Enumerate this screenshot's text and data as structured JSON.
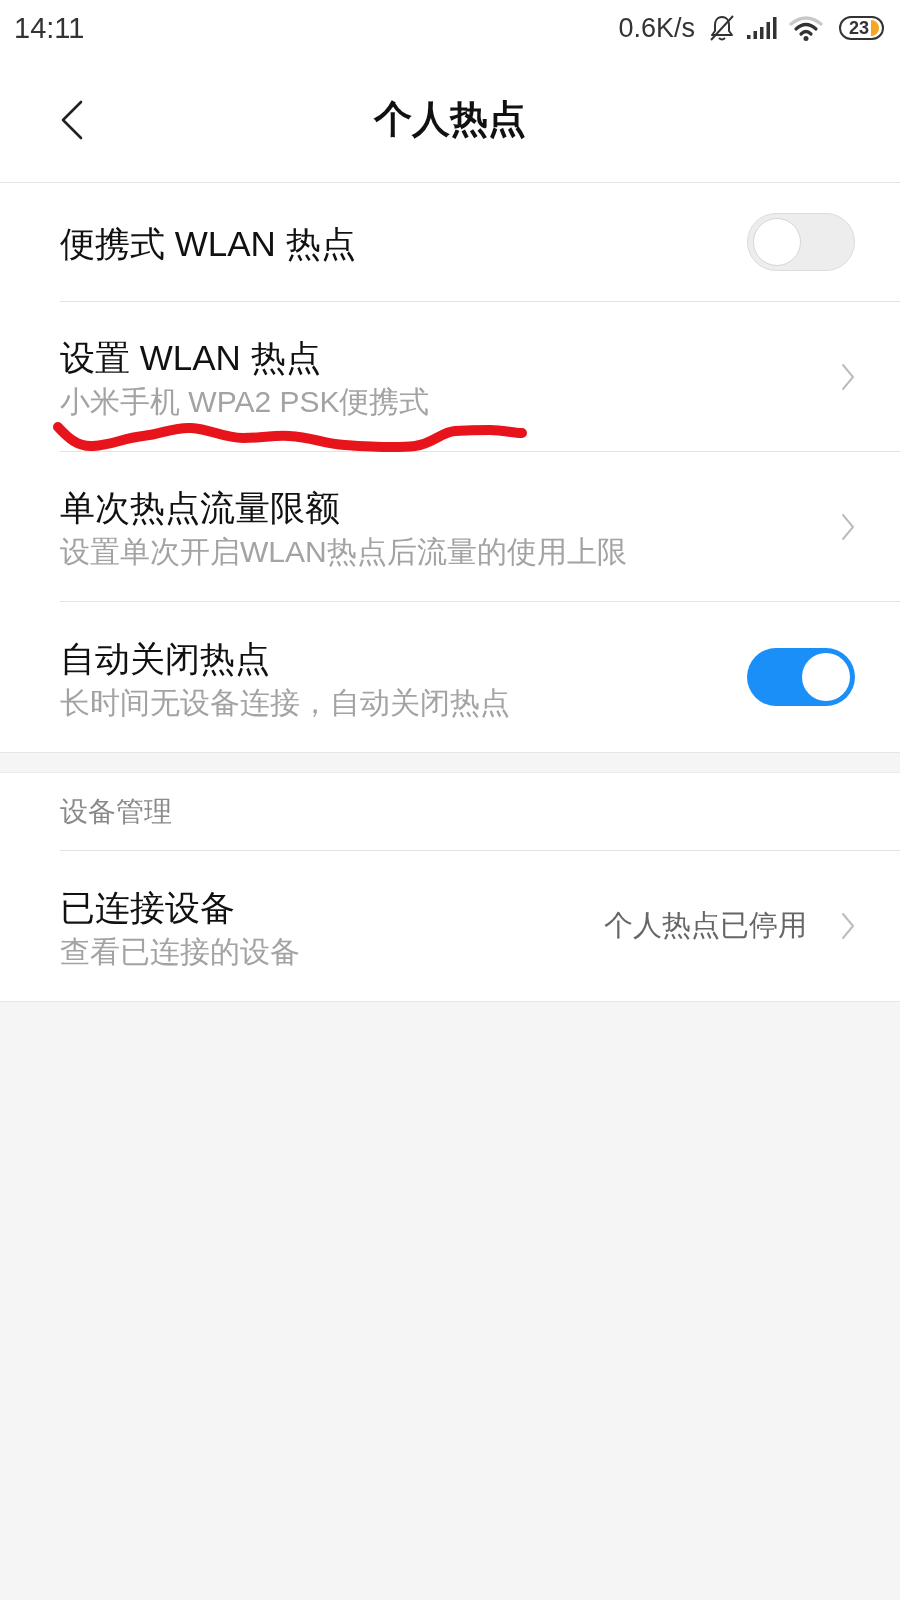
{
  "status_bar": {
    "time": "14:11",
    "net_speed": "0.6K/s",
    "battery": "23"
  },
  "header": {
    "title": "个人热点"
  },
  "groups": [
    {
      "items": [
        {
          "kind": "switch",
          "title": "便携式 WLAN 热点",
          "on": false,
          "underlined": false
        },
        {
          "kind": "link",
          "title": "设置 WLAN 热点",
          "subtitle": "小米手机 WPA2 PSK便携式",
          "underlined": true
        },
        {
          "kind": "link",
          "title": "单次热点流量限额",
          "subtitle": "设置单次开启WLAN热点后流量的使用上限",
          "underlined": false
        },
        {
          "kind": "switch",
          "title": "自动关闭热点",
          "subtitle": "长时间无设备连接，自动关闭热点",
          "on": true,
          "underlined": false
        }
      ]
    },
    {
      "header": "设备管理",
      "items": [
        {
          "kind": "link",
          "title": "已连接设备",
          "subtitle": "查看已连接的设备",
          "value": "个人热点已停用",
          "underlined": false
        }
      ]
    }
  ]
}
